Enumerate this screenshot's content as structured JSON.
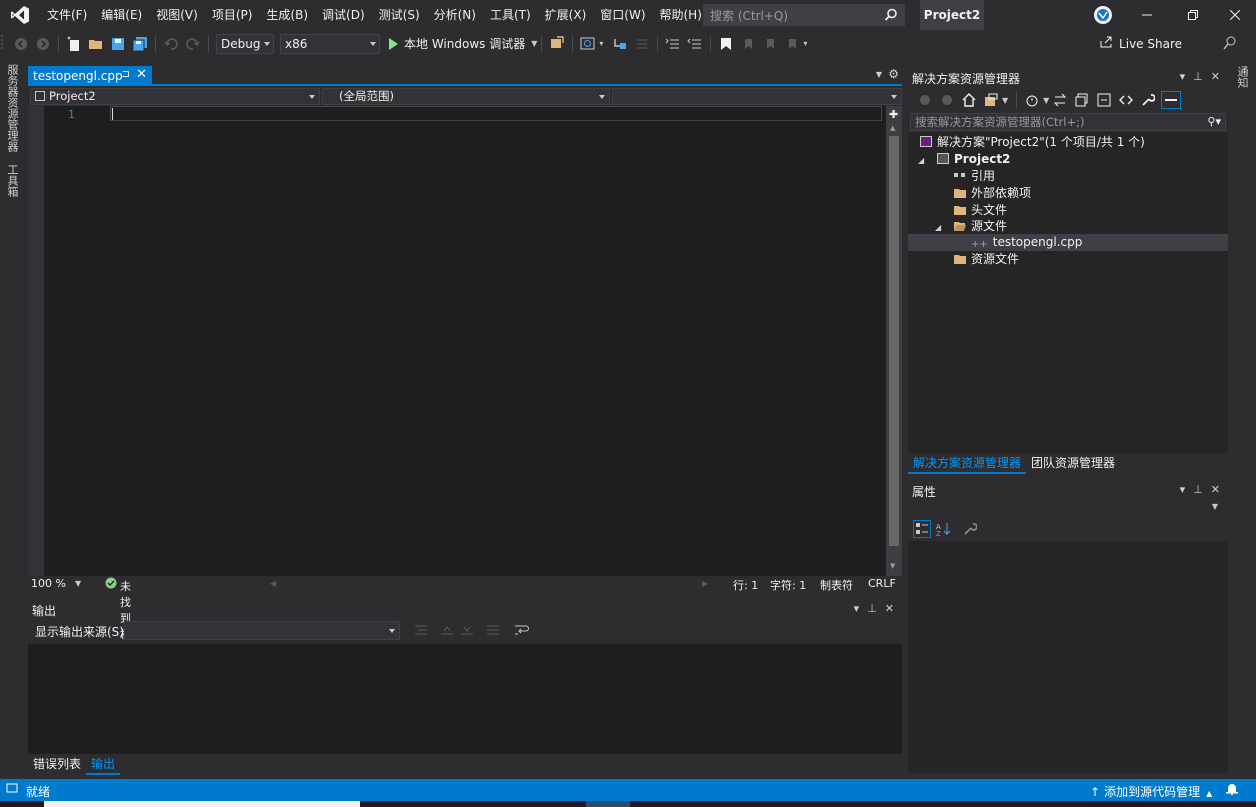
{
  "menu": [
    "文件(F)",
    "编辑(E)",
    "视图(V)",
    "项目(P)",
    "生成(B)",
    "调试(D)",
    "测试(S)",
    "分析(N)",
    "工具(T)",
    "扩展(X)",
    "窗口(W)",
    "帮助(H)"
  ],
  "search": {
    "placeholder": "搜索 (Ctrl+Q)"
  },
  "project_title": "Project2",
  "toolbar": {
    "config": "Debug",
    "platform": "x86",
    "run_label": "本地 Windows 调试器",
    "live_share": "Live Share"
  },
  "left_strip": {
    "server_explorer": "服务器资源管理器",
    "toolbox": "工具箱"
  },
  "right_strip": {
    "notifications": "通知"
  },
  "editor": {
    "tab_label": "testopengl.cpp",
    "nav_project": "Project2",
    "nav_scope": "(全局范围)",
    "line_number": "1",
    "zoom": "100 %",
    "issues": "未找到相关问题",
    "line": "行: 1",
    "col": "字符: 1",
    "tabs_mode": "制表符",
    "eol": "CRLF"
  },
  "output": {
    "title": "输出",
    "source_label": "显示输出来源(S):",
    "tabs": [
      "错误列表",
      "输出"
    ]
  },
  "solution_explorer": {
    "title": "解决方案资源管理器",
    "search_placeholder": "搜索解决方案资源管理器(Ctrl+;)",
    "solution": "解决方案\"Project2\"(1 个项目/共 1 个)",
    "project": "Project2",
    "items": {
      "references": "引用",
      "external": "外部依赖项",
      "headers": "头文件",
      "sources": "源文件",
      "file": "testopengl.cpp",
      "resources": "资源文件"
    },
    "tabs": [
      "解决方案资源管理器",
      "团队资源管理器"
    ]
  },
  "properties": {
    "title": "属性"
  },
  "statusbar": {
    "ready": "就绪",
    "source_control": "添加到源代码管理"
  },
  "colors": {
    "accent": "#007acc",
    "background": "#2d2d30",
    "editor": "#1e1e1e"
  }
}
